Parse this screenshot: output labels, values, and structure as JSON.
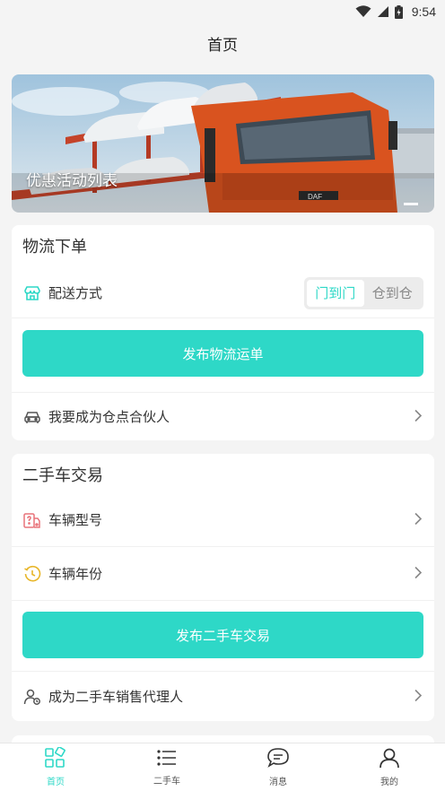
{
  "status_bar": {
    "time": "9:54"
  },
  "nav": {
    "title": "首页"
  },
  "banner": {
    "caption": "优惠活动列表"
  },
  "logistics": {
    "title": "物流下单",
    "delivery": {
      "label": "配送方式",
      "options": [
        "门到门",
        "仓到仓"
      ],
      "selected": "门到门"
    },
    "submit_label": "发布物流运单",
    "partner_label": "我要成为仓点合伙人"
  },
  "used_car": {
    "title": "二手车交易",
    "model_label": "车辆型号",
    "year_label": "车辆年份",
    "submit_label": "发布二手车交易",
    "agent_label": "成为二手车销售代理人"
  },
  "tabbar": {
    "items": [
      {
        "label": "首页",
        "icon": "home-grid-icon",
        "active": true
      },
      {
        "label": "二手车",
        "icon": "list-icon",
        "active": false
      },
      {
        "label": "消息",
        "icon": "message-icon",
        "active": false
      },
      {
        "label": "我的",
        "icon": "user-icon",
        "active": false
      }
    ]
  },
  "colors": {
    "accent": "#2ed8c7",
    "background": "#f4f4f4"
  }
}
